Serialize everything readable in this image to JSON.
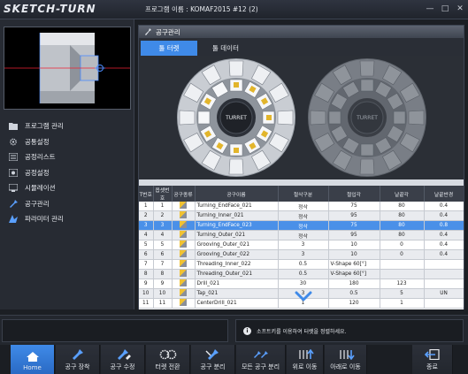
{
  "app": {
    "logo": "SKETCH-TURN",
    "project_title": "프로그램 이름 : KOMAF2015 #12 (2)",
    "minimize": "—",
    "restore": "□",
    "close": "✕"
  },
  "sidebar": {
    "items": [
      {
        "label": "프로그램 관리",
        "icon": "folder-icon"
      },
      {
        "label": "공통설정",
        "icon": "gear-icon"
      },
      {
        "label": "공정리스트",
        "icon": "list-icon"
      },
      {
        "label": "공정설정",
        "icon": "process-settings-icon"
      },
      {
        "label": "시뮬레이션",
        "icon": "simulation-icon"
      },
      {
        "label": "공구관리",
        "icon": "tool-icon"
      },
      {
        "label": "파라미터 관리",
        "icon": "parameter-icon"
      }
    ]
  },
  "panel": {
    "title": "공구관리",
    "tabs": [
      {
        "label": "툴 터렛",
        "active": true
      },
      {
        "label": "툴 데이터",
        "active": false
      }
    ],
    "turret_label_left": "TURRET",
    "turret_label_right": "TURRET"
  },
  "table": {
    "columns": [
      "T번호",
      "옵셋번호",
      "공구종류",
      "공구이름",
      "절삭구분",
      "절입각",
      "날끝각",
      "날끝반경"
    ],
    "rows": [
      [
        "1",
        "1",
        "",
        "Turning_EndFace_021",
        "정삭",
        "75",
        "80",
        "0.4"
      ],
      [
        "2",
        "2",
        "",
        "Turning_Inner_021",
        "정삭",
        "95",
        "80",
        "0.4"
      ],
      [
        "3",
        "3",
        "",
        "Turning_EndFace_023",
        "정삭",
        "75",
        "80",
        "0.8"
      ],
      [
        "4",
        "4",
        "",
        "Turning_Outer_021",
        "정삭",
        "95",
        "80",
        "0.4"
      ],
      [
        "5",
        "5",
        "",
        "Grooving_Outer_021",
        "3",
        "10",
        "0",
        "0.4"
      ],
      [
        "6",
        "6",
        "",
        "Grooving_Outer_022",
        "3",
        "10",
        "0",
        "0.4"
      ],
      [
        "7",
        "7",
        "",
        "Threading_Inner_022",
        "0.5",
        "V-Shape 60[°]",
        "",
        ""
      ],
      [
        "8",
        "8",
        "",
        "Threading_Outer_021",
        "0.5",
        "V-Shape 60[°]",
        "",
        ""
      ],
      [
        "9",
        "9",
        "",
        "Drill_021",
        "30",
        "180",
        "123",
        ""
      ],
      [
        "10",
        "10",
        "",
        "Tap_021",
        "3",
        "0.5",
        "5",
        "UN"
      ],
      [
        "11",
        "11",
        "",
        "CenterDrill_021",
        "1",
        "120",
        "1",
        ""
      ]
    ],
    "selected_row": 3
  },
  "status": {
    "info_icon": "i",
    "message": "소프트키를 이용하여 터렛을 정렬하세요."
  },
  "toolbar": {
    "buttons": [
      {
        "label": "Home",
        "icon": "home-icon"
      },
      {
        "label": "공구 장착",
        "icon": "tool-mount-icon"
      },
      {
        "label": "공구 수정",
        "icon": "tool-edit-icon"
      },
      {
        "label": "터렛 전환",
        "icon": "turret-switch-icon"
      },
      {
        "label": "공구 분리",
        "icon": "tool-detach-icon"
      },
      {
        "label": "모든 공구 분리",
        "icon": "detach-all-icon"
      },
      {
        "label": "위로 이동",
        "icon": "move-up-icon"
      },
      {
        "label": "아래로 이동",
        "icon": "move-down-icon"
      },
      {
        "label": "종료",
        "icon": "exit-icon"
      }
    ]
  },
  "colors": {
    "accent": "#3f8ae8",
    "selected_row": "#4a90e8",
    "background": "#1c1f24"
  }
}
